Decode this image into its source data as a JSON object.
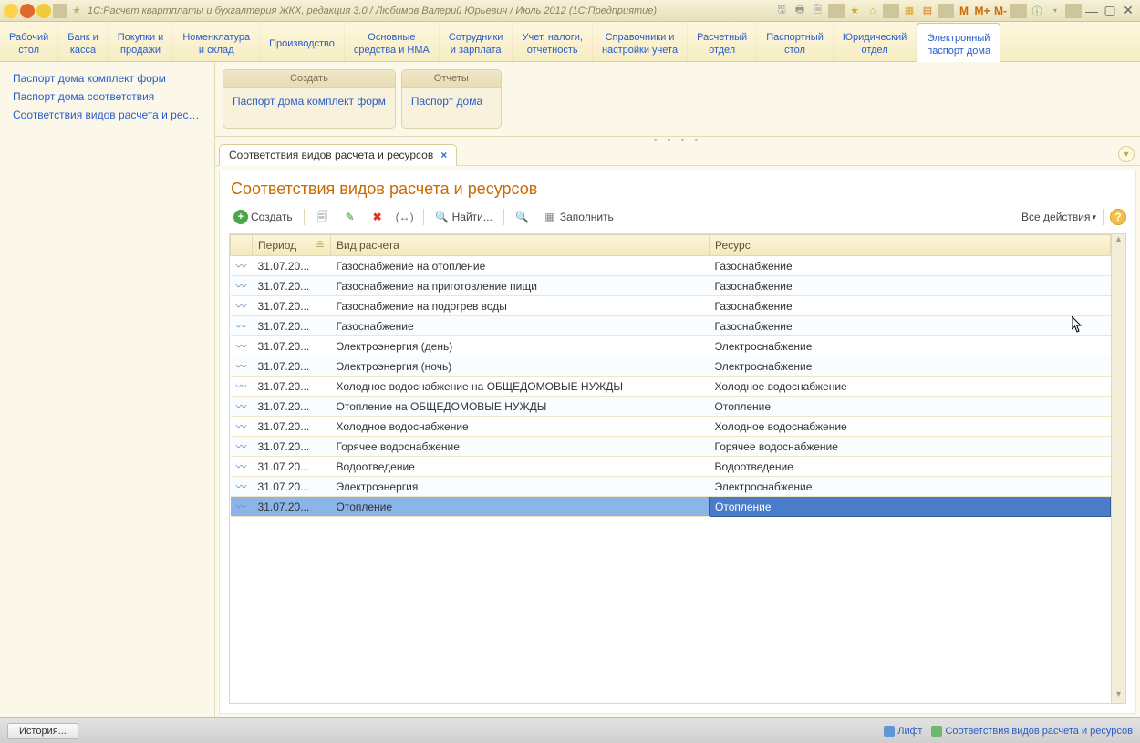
{
  "title": "1С:Расчет квартплаты и бухгалтерия ЖКХ, редакция 3.0 / Любимов Валерий Юрьевич / Июль 2012  (1С:Предприятие)",
  "main_tabs": [
    {
      "l1": "Рабочий",
      "l2": "стол"
    },
    {
      "l1": "Банк и",
      "l2": "касса"
    },
    {
      "l1": "Покупки и",
      "l2": "продажи"
    },
    {
      "l1": "Номенклатура",
      "l2": "и склад"
    },
    {
      "l1": "Производство",
      "l2": ""
    },
    {
      "l1": "Основные",
      "l2": "средства и НМА"
    },
    {
      "l1": "Сотрудники",
      "l2": "и зарплата"
    },
    {
      "l1": "Учет, налоги,",
      "l2": "отчетность"
    },
    {
      "l1": "Справочники и",
      "l2": "настройки учета"
    },
    {
      "l1": "Расчетный",
      "l2": "отдел"
    },
    {
      "l1": "Паспортный",
      "l2": "стол"
    },
    {
      "l1": "Юридический",
      "l2": "отдел"
    },
    {
      "l1": "Электронный",
      "l2": "паспорт дома"
    }
  ],
  "main_tab_active": 12,
  "left_nav": [
    "Паспорт дома комплект форм",
    "Паспорт дома соответствия",
    "Соответствия видов расчета и ресурс..."
  ],
  "panel_create": {
    "title": "Создать",
    "link": "Паспорт дома комплект форм"
  },
  "panel_reports": {
    "title": "Отчеты",
    "link": "Паспорт дома"
  },
  "doc_tab": "Соответствия видов расчета и ресурсов",
  "doc_title": "Соответствия видов расчета и ресурсов",
  "toolbar": {
    "create": "Создать",
    "find": "Найти...",
    "fill": "Заполнить",
    "all_actions": "Все действия"
  },
  "columns": {
    "period": "Период",
    "calc": "Вид расчета",
    "resource": "Ресурс"
  },
  "rows": [
    {
      "p": "31.07.20...",
      "c": "Газоснабжение на отопление",
      "r": "Газоснабжение"
    },
    {
      "p": "31.07.20...",
      "c": "Газоснабжение на приготовление пищи",
      "r": "Газоснабжение"
    },
    {
      "p": "31.07.20...",
      "c": "Газоснабжение на подогрев воды",
      "r": "Газоснабжение"
    },
    {
      "p": "31.07.20...",
      "c": "Газоснабжение",
      "r": "Газоснабжение"
    },
    {
      "p": "31.07.20...",
      "c": "Электроэнергия (день)",
      "r": "Электроснабжение"
    },
    {
      "p": "31.07.20...",
      "c": "Электроэнергия (ночь)",
      "r": "Электроснабжение"
    },
    {
      "p": "31.07.20...",
      "c": "Холодное водоснабжение на ОБЩЕДОМОВЫЕ НУЖДЫ",
      "r": "Холодное водоснабжение"
    },
    {
      "p": "31.07.20...",
      "c": "Отопление на ОБЩЕДОМОВЫЕ НУЖДЫ",
      "r": "Отопление"
    },
    {
      "p": "31.07.20...",
      "c": "Холодное водоснабжение",
      "r": "Холодное водоснабжение"
    },
    {
      "p": "31.07.20...",
      "c": "Горячее водоснабжение",
      "r": "Горячее водоснабжение"
    },
    {
      "p": "31.07.20...",
      "c": "Водоотведение",
      "r": "Водоотведение"
    },
    {
      "p": "31.07.20...",
      "c": "Электроэнергия",
      "r": "Электроснабжение"
    },
    {
      "p": "31.07.20...",
      "c": "Отопление",
      "r": "Отопление"
    }
  ],
  "selected_row": 12,
  "status": {
    "history": "История...",
    "lift": "Лифт",
    "corr": "Соответствия видов расчета и ресурсов"
  }
}
